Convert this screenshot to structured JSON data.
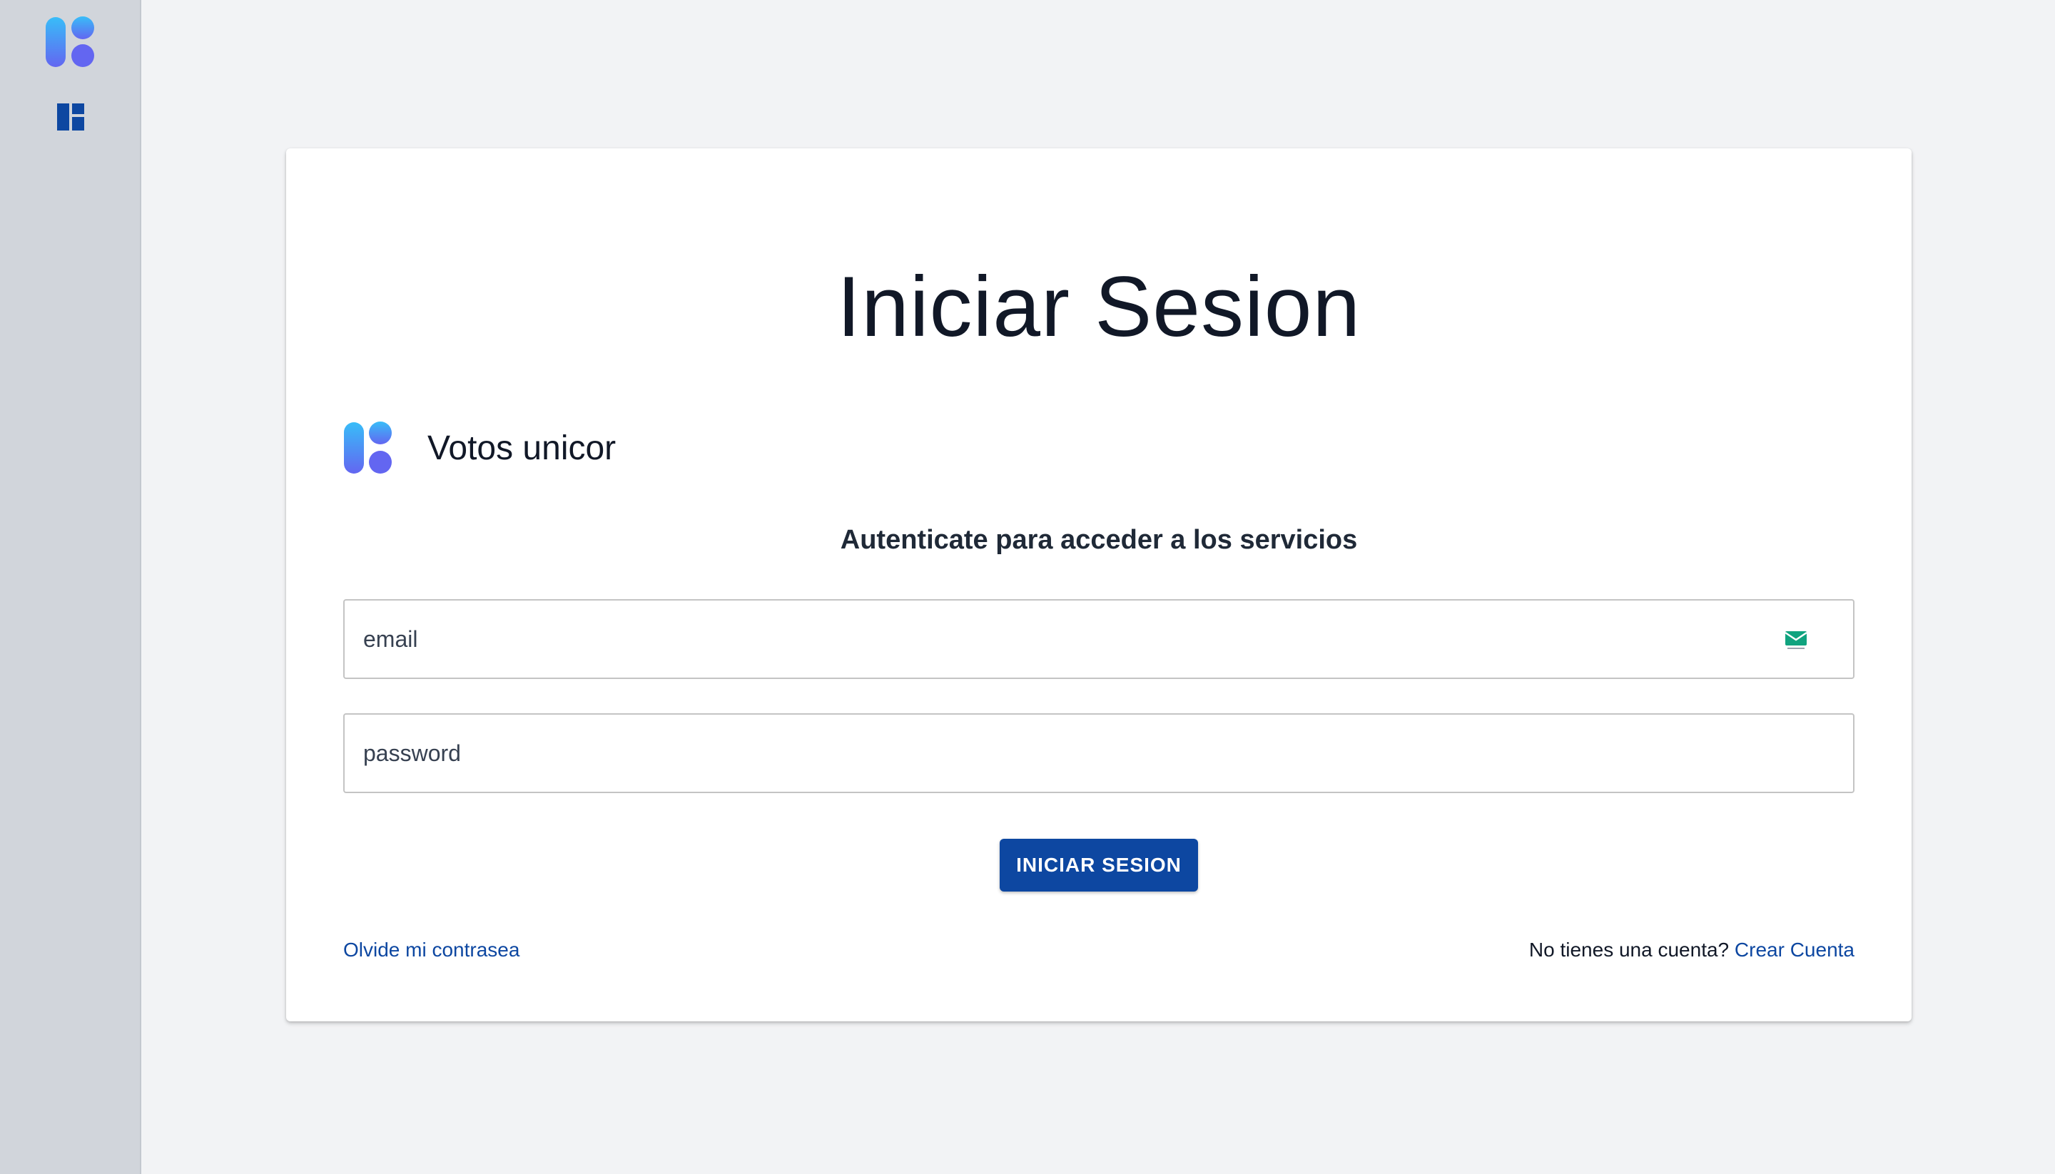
{
  "sidebar": {
    "logo_icon": "app-logo-icon",
    "dashboard_icon": "dashboard-icon"
  },
  "login": {
    "title": "Iniciar Sesion",
    "brand_name": "Votos unicor",
    "subtitle": "Autenticate para acceder a los servicios",
    "email_placeholder": "email",
    "email_icon": "mail-icon",
    "password_placeholder": "password",
    "submit_label": "INICIAR SESION",
    "forgot_label": "Olvide mi contrasea",
    "no_account_text": "No tienes una cuenta?",
    "create_account_label": "Crear Cuenta"
  },
  "colors": {
    "primary": "#0d47a1",
    "background": "#f2f3f5",
    "sidebar": "#d1d5db",
    "logo_gradient_start": "#38bdf8",
    "logo_gradient_end": "#6366f1"
  }
}
